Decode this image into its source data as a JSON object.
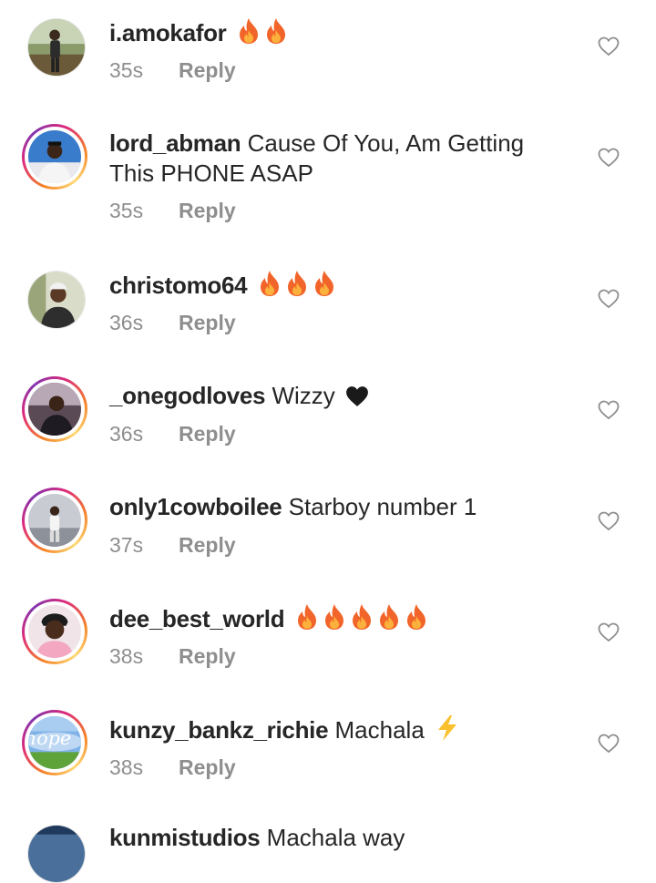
{
  "comments": [
    {
      "username": "i.amokafor",
      "text": "",
      "emoji": [
        "fire-icon",
        "fire-icon"
      ],
      "time": "35s",
      "reply": "Reply"
    },
    {
      "username": "lord_abman",
      "text": "Cause Of You, Am Getting This PHONE ASAP",
      "emoji": [],
      "time": "35s",
      "reply": "Reply"
    },
    {
      "username": "christomo64",
      "text": "",
      "emoji": [
        "fire-icon",
        "fire-icon",
        "fire-icon"
      ],
      "time": "36s",
      "reply": "Reply"
    },
    {
      "username": "_onegodloves",
      "text": "Wizzy",
      "emoji": [
        "black-heart-icon"
      ],
      "time": "36s",
      "reply": "Reply"
    },
    {
      "username": "only1cowboilee",
      "text": "Starboy number 1",
      "emoji": [],
      "time": "37s",
      "reply": "Reply"
    },
    {
      "username": "dee_best_world",
      "text": "",
      "emoji": [
        "fire-icon",
        "fire-icon",
        "fire-icon",
        "fire-icon",
        "fire-icon"
      ],
      "time": "38s",
      "reply": "Reply"
    },
    {
      "username": "kunzy_bankz_richie",
      "text": "Machala",
      "emoji": [
        "lightning-icon"
      ],
      "time": "38s",
      "reply": "Reply"
    },
    {
      "username": "kunmistudios",
      "text": "Machala way",
      "emoji": [],
      "time": "",
      "reply": ""
    }
  ],
  "avatar_texts": {
    "kunzy_bankz_richie": "hope"
  },
  "colors": {
    "text": "#262626",
    "meta": "#8e8e8e",
    "ring_start": "#f58529",
    "ring_mid": "#dd2a7b",
    "ring_end": "#8134af"
  }
}
